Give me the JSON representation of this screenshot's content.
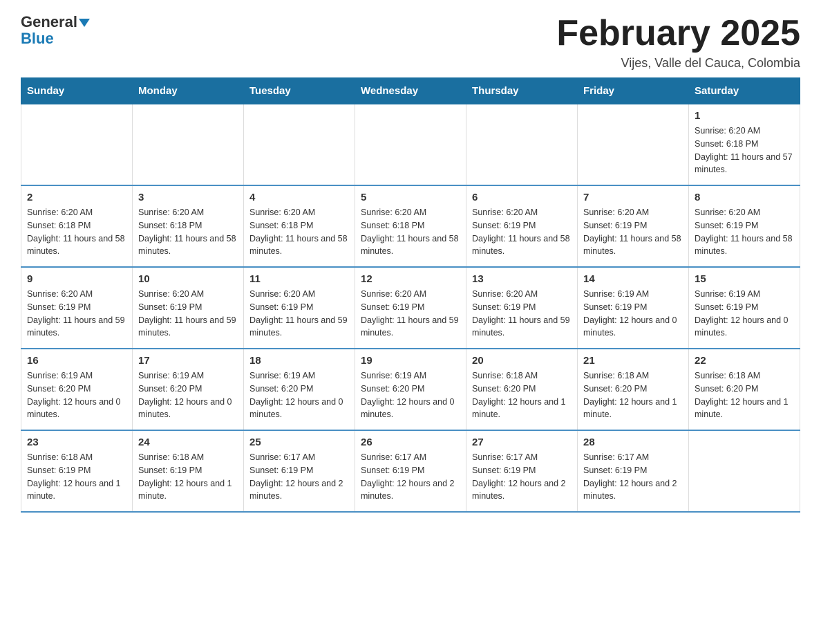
{
  "logo": {
    "general": "General",
    "blue": "Blue"
  },
  "title": "February 2025",
  "subtitle": "Vijes, Valle del Cauca, Colombia",
  "days_of_week": [
    "Sunday",
    "Monday",
    "Tuesday",
    "Wednesday",
    "Thursday",
    "Friday",
    "Saturday"
  ],
  "weeks": [
    [
      {
        "day": "",
        "sunrise": "",
        "sunset": "",
        "daylight": ""
      },
      {
        "day": "",
        "sunrise": "",
        "sunset": "",
        "daylight": ""
      },
      {
        "day": "",
        "sunrise": "",
        "sunset": "",
        "daylight": ""
      },
      {
        "day": "",
        "sunrise": "",
        "sunset": "",
        "daylight": ""
      },
      {
        "day": "",
        "sunrise": "",
        "sunset": "",
        "daylight": ""
      },
      {
        "day": "",
        "sunrise": "",
        "sunset": "",
        "daylight": ""
      },
      {
        "day": "1",
        "sunrise": "Sunrise: 6:20 AM",
        "sunset": "Sunset: 6:18 PM",
        "daylight": "Daylight: 11 hours and 57 minutes."
      }
    ],
    [
      {
        "day": "2",
        "sunrise": "Sunrise: 6:20 AM",
        "sunset": "Sunset: 6:18 PM",
        "daylight": "Daylight: 11 hours and 58 minutes."
      },
      {
        "day": "3",
        "sunrise": "Sunrise: 6:20 AM",
        "sunset": "Sunset: 6:18 PM",
        "daylight": "Daylight: 11 hours and 58 minutes."
      },
      {
        "day": "4",
        "sunrise": "Sunrise: 6:20 AM",
        "sunset": "Sunset: 6:18 PM",
        "daylight": "Daylight: 11 hours and 58 minutes."
      },
      {
        "day": "5",
        "sunrise": "Sunrise: 6:20 AM",
        "sunset": "Sunset: 6:18 PM",
        "daylight": "Daylight: 11 hours and 58 minutes."
      },
      {
        "day": "6",
        "sunrise": "Sunrise: 6:20 AM",
        "sunset": "Sunset: 6:19 PM",
        "daylight": "Daylight: 11 hours and 58 minutes."
      },
      {
        "day": "7",
        "sunrise": "Sunrise: 6:20 AM",
        "sunset": "Sunset: 6:19 PM",
        "daylight": "Daylight: 11 hours and 58 minutes."
      },
      {
        "day": "8",
        "sunrise": "Sunrise: 6:20 AM",
        "sunset": "Sunset: 6:19 PM",
        "daylight": "Daylight: 11 hours and 58 minutes."
      }
    ],
    [
      {
        "day": "9",
        "sunrise": "Sunrise: 6:20 AM",
        "sunset": "Sunset: 6:19 PM",
        "daylight": "Daylight: 11 hours and 59 minutes."
      },
      {
        "day": "10",
        "sunrise": "Sunrise: 6:20 AM",
        "sunset": "Sunset: 6:19 PM",
        "daylight": "Daylight: 11 hours and 59 minutes."
      },
      {
        "day": "11",
        "sunrise": "Sunrise: 6:20 AM",
        "sunset": "Sunset: 6:19 PM",
        "daylight": "Daylight: 11 hours and 59 minutes."
      },
      {
        "day": "12",
        "sunrise": "Sunrise: 6:20 AM",
        "sunset": "Sunset: 6:19 PM",
        "daylight": "Daylight: 11 hours and 59 minutes."
      },
      {
        "day": "13",
        "sunrise": "Sunrise: 6:20 AM",
        "sunset": "Sunset: 6:19 PM",
        "daylight": "Daylight: 11 hours and 59 minutes."
      },
      {
        "day": "14",
        "sunrise": "Sunrise: 6:19 AM",
        "sunset": "Sunset: 6:19 PM",
        "daylight": "Daylight: 12 hours and 0 minutes."
      },
      {
        "day": "15",
        "sunrise": "Sunrise: 6:19 AM",
        "sunset": "Sunset: 6:19 PM",
        "daylight": "Daylight: 12 hours and 0 minutes."
      }
    ],
    [
      {
        "day": "16",
        "sunrise": "Sunrise: 6:19 AM",
        "sunset": "Sunset: 6:20 PM",
        "daylight": "Daylight: 12 hours and 0 minutes."
      },
      {
        "day": "17",
        "sunrise": "Sunrise: 6:19 AM",
        "sunset": "Sunset: 6:20 PM",
        "daylight": "Daylight: 12 hours and 0 minutes."
      },
      {
        "day": "18",
        "sunrise": "Sunrise: 6:19 AM",
        "sunset": "Sunset: 6:20 PM",
        "daylight": "Daylight: 12 hours and 0 minutes."
      },
      {
        "day": "19",
        "sunrise": "Sunrise: 6:19 AM",
        "sunset": "Sunset: 6:20 PM",
        "daylight": "Daylight: 12 hours and 0 minutes."
      },
      {
        "day": "20",
        "sunrise": "Sunrise: 6:18 AM",
        "sunset": "Sunset: 6:20 PM",
        "daylight": "Daylight: 12 hours and 1 minute."
      },
      {
        "day": "21",
        "sunrise": "Sunrise: 6:18 AM",
        "sunset": "Sunset: 6:20 PM",
        "daylight": "Daylight: 12 hours and 1 minute."
      },
      {
        "day": "22",
        "sunrise": "Sunrise: 6:18 AM",
        "sunset": "Sunset: 6:20 PM",
        "daylight": "Daylight: 12 hours and 1 minute."
      }
    ],
    [
      {
        "day": "23",
        "sunrise": "Sunrise: 6:18 AM",
        "sunset": "Sunset: 6:19 PM",
        "daylight": "Daylight: 12 hours and 1 minute."
      },
      {
        "day": "24",
        "sunrise": "Sunrise: 6:18 AM",
        "sunset": "Sunset: 6:19 PM",
        "daylight": "Daylight: 12 hours and 1 minute."
      },
      {
        "day": "25",
        "sunrise": "Sunrise: 6:17 AM",
        "sunset": "Sunset: 6:19 PM",
        "daylight": "Daylight: 12 hours and 2 minutes."
      },
      {
        "day": "26",
        "sunrise": "Sunrise: 6:17 AM",
        "sunset": "Sunset: 6:19 PM",
        "daylight": "Daylight: 12 hours and 2 minutes."
      },
      {
        "day": "27",
        "sunrise": "Sunrise: 6:17 AM",
        "sunset": "Sunset: 6:19 PM",
        "daylight": "Daylight: 12 hours and 2 minutes."
      },
      {
        "day": "28",
        "sunrise": "Sunrise: 6:17 AM",
        "sunset": "Sunset: 6:19 PM",
        "daylight": "Daylight: 12 hours and 2 minutes."
      },
      {
        "day": "",
        "sunrise": "",
        "sunset": "",
        "daylight": ""
      }
    ]
  ]
}
